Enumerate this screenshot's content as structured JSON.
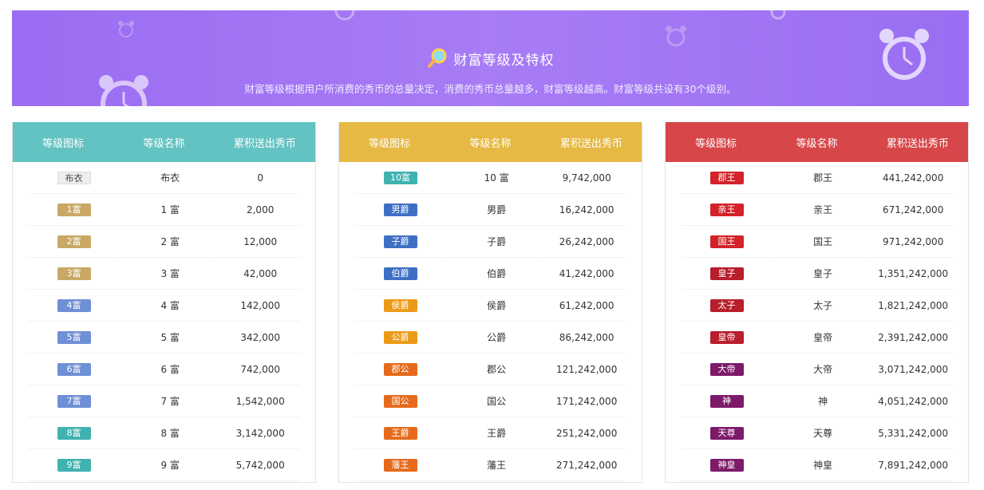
{
  "banner": {
    "title": "财富等级及特权",
    "subtitle": "财富等级根据用户所消费的秀币的总量决定，消费的秀币总量越多，财富等级越高。财富等级共设有30个级别。"
  },
  "columns": [
    "等级图标",
    "等级名称",
    "累积送出秀币"
  ],
  "colors": {
    "panel1": "#62c3c2",
    "panel2": "#e6b944",
    "panel3": "#d74649"
  },
  "panels": [
    {
      "rows": [
        {
          "badge": "布衣",
          "name": "布衣",
          "value": "0",
          "style": "plain"
        },
        {
          "badge": "1富",
          "name": "1 富",
          "value": "2,000",
          "style": "gold"
        },
        {
          "badge": "2富",
          "name": "2 富",
          "value": "12,000",
          "style": "gold"
        },
        {
          "badge": "3富",
          "name": "3 富",
          "value": "42,000",
          "style": "gold"
        },
        {
          "badge": "4富",
          "name": "4 富",
          "value": "142,000",
          "style": "blue"
        },
        {
          "badge": "5富",
          "name": "5 富",
          "value": "342,000",
          "style": "blue"
        },
        {
          "badge": "6富",
          "name": "6 富",
          "value": "742,000",
          "style": "blue"
        },
        {
          "badge": "7富",
          "name": "7 富",
          "value": "1,542,000",
          "style": "blue"
        },
        {
          "badge": "8富",
          "name": "8 富",
          "value": "3,142,000",
          "style": "teal"
        },
        {
          "badge": "9富",
          "name": "9 富",
          "value": "5,742,000",
          "style": "teal"
        }
      ]
    },
    {
      "rows": [
        {
          "badge": "10富",
          "name": "10 富",
          "value": "9,742,000",
          "style": "teal"
        },
        {
          "badge": "男爵",
          "name": "男爵",
          "value": "16,242,000",
          "style": "navy"
        },
        {
          "badge": "子爵",
          "name": "子爵",
          "value": "26,242,000",
          "style": "navy"
        },
        {
          "badge": "伯爵",
          "name": "伯爵",
          "value": "41,242,000",
          "style": "navy"
        },
        {
          "badge": "侯爵",
          "name": "侯爵",
          "value": "61,242,000",
          "style": "orange"
        },
        {
          "badge": "公爵",
          "name": "公爵",
          "value": "86,242,000",
          "style": "orange"
        },
        {
          "badge": "郡公",
          "name": "郡公",
          "value": "121,242,000",
          "style": "orangered"
        },
        {
          "badge": "国公",
          "name": "国公",
          "value": "171,242,000",
          "style": "orangered"
        },
        {
          "badge": "王爵",
          "name": "王爵",
          "value": "251,242,000",
          "style": "orangered"
        },
        {
          "badge": "藩王",
          "name": "藩王",
          "value": "271,242,000",
          "style": "orangered"
        }
      ]
    },
    {
      "rows": [
        {
          "badge": "郡王",
          "name": "郡王",
          "value": "441,242,000",
          "style": "red"
        },
        {
          "badge": "亲王",
          "name": "亲王",
          "value": "671,242,000",
          "style": "red"
        },
        {
          "badge": "国王",
          "name": "国王",
          "value": "971,242,000",
          "style": "red"
        },
        {
          "badge": "皇子",
          "name": "皇子",
          "value": "1,351,242,000",
          "style": "crimson"
        },
        {
          "badge": "太子",
          "name": "太子",
          "value": "1,821,242,000",
          "style": "crimson"
        },
        {
          "badge": "皇帝",
          "name": "皇帝",
          "value": "2,391,242,000",
          "style": "crimson"
        },
        {
          "badge": "大帝",
          "name": "大帝",
          "value": "3,071,242,000",
          "style": "purple"
        },
        {
          "badge": "神",
          "name": "神",
          "value": "4,051,242,000",
          "style": "purple"
        },
        {
          "badge": "天尊",
          "name": "天尊",
          "value": "5,331,242,000",
          "style": "purple"
        },
        {
          "badge": "神皇",
          "name": "神皇",
          "value": "7,891,242,000",
          "style": "purple"
        }
      ]
    }
  ],
  "badge_colors": {
    "plain": "#eeeeee",
    "gold": "#c9a865",
    "blue": "#6f8fd6",
    "teal": "#3fb2b1",
    "navy": "#3f6fc4",
    "orange": "#eb9a18",
    "orangered": "#e56a1c",
    "red": "#d3232a",
    "crimson": "#b81e2b",
    "purple": "#7d1a6a"
  }
}
